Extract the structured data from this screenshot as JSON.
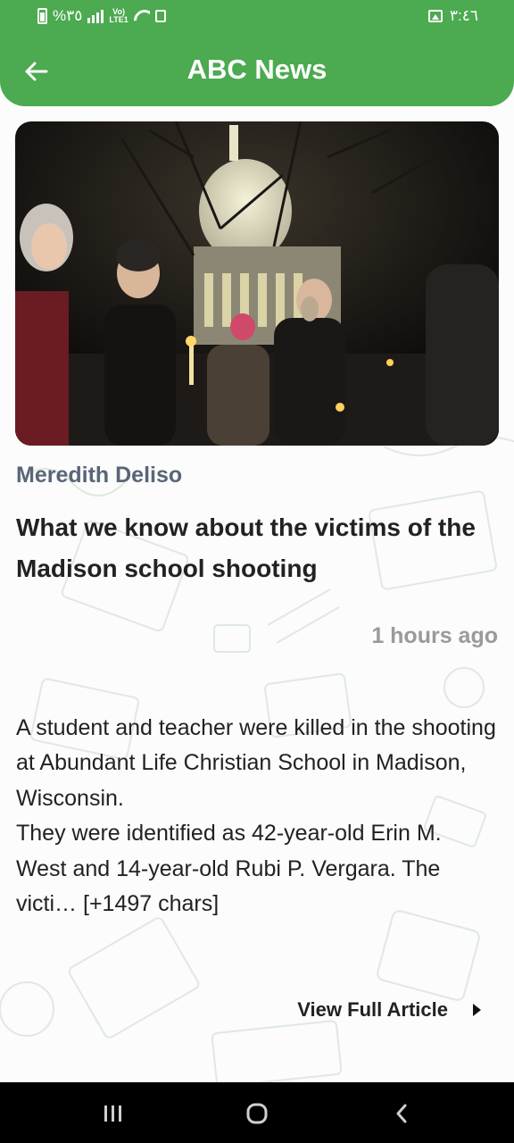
{
  "status_bar": {
    "battery_text": "%٣٥",
    "lte_top": "Vo)",
    "lte_bottom": "LTE1",
    "time": "٣:٤٦"
  },
  "header": {
    "title": "ABC News",
    "back_icon": "arrow-left-icon"
  },
  "article": {
    "author": "Meredith Deliso",
    "headline": "What we know about the victims of the Madison school shooting",
    "time_ago": "1 hours ago",
    "body": "A student and teacher were killed in the shooting at Abundant Life Christian School in Madison, Wisconsin.\nThey were identified as 42-year-old Erin M. West and 14-year-old Rubi P. Vergara. The victi… [+1497 chars]",
    "view_full_label": "View Full Article"
  },
  "colors": {
    "header_bg": "#4caa50",
    "author": "#5a6577",
    "time": "#9a9a9a"
  },
  "nav": {
    "recents_icon": "recents-icon",
    "home_icon": "home-icon",
    "back_icon": "back-chevron-icon"
  }
}
